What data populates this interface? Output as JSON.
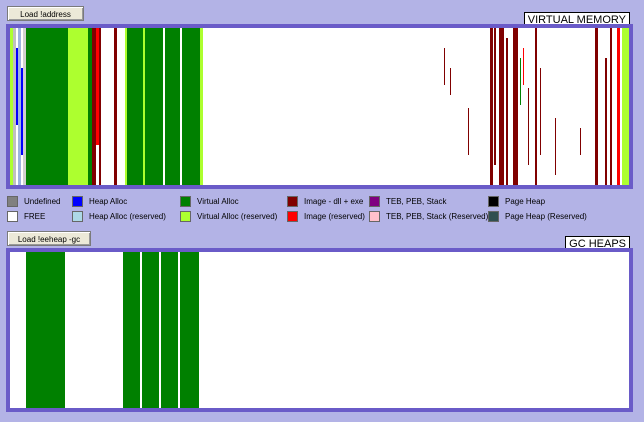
{
  "buttons": {
    "load_address": "Load !address",
    "load_eeheap": "Load !eeheap -gc"
  },
  "panels": {
    "virtual_memory_title": "VIRTUAL MEMORY",
    "gc_heaps_title": "GC HEAPS"
  },
  "legend": [
    {
      "label": "Undefined",
      "color": "#808080"
    },
    {
      "label": "Heap Alloc",
      "color": "#0000ff"
    },
    {
      "label": "Virtual Alloc",
      "color": "#008000"
    },
    {
      "label": "Image - dll + exe",
      "color": "#800000"
    },
    {
      "label": "TEB, PEB, Stack",
      "color": "#800080"
    },
    {
      "label": "Page Heap",
      "color": "#000000"
    },
    {
      "label": "FREE",
      "color": "#ffffff"
    },
    {
      "label": "Heap Alloc (reserved)",
      "color": "#add8e6"
    },
    {
      "label": "Virtual Alloc (reserved)",
      "color": "#adff2f"
    },
    {
      "label": "Image (reserved)",
      "color": "#ff0000"
    },
    {
      "label": "TEB, PEB, Stack (Reserved)",
      "color": "#ffc0cb"
    },
    {
      "label": "Page Heap (Reserved)",
      "color": "#2f4f4f"
    }
  ],
  "colors": {
    "background": "#b3b3e6",
    "panel_border": "#6a5bc8",
    "virtual_alloc": "#008000",
    "virtual_alloc_reserved": "#adff2f",
    "image": "#800000",
    "image_reserved": "#ff0000",
    "heap_alloc": "#0000ff",
    "free": "#ffffff"
  }
}
